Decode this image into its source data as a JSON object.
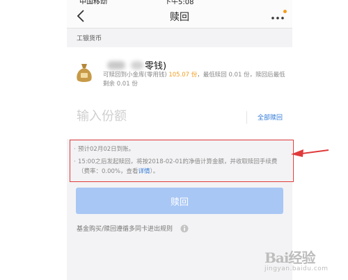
{
  "statusbar": {
    "left_fragment": "中国移动",
    "center_fragment": "下午5:08"
  },
  "nav": {
    "title": "赎回",
    "more_badge_color": "#f39c1e"
  },
  "section_label": "工银货币",
  "fund": {
    "name_visible": "零钱)",
    "desc_prefix": "可赎回到小金库(零用钱) ",
    "redeemable_shares": "105.07 份",
    "desc_suffix": "，最低赎回 0.01 份，赎回后最低剩余 0.01 份",
    "icon": "money-bag-icon"
  },
  "amount": {
    "placeholder": "输入份额",
    "value": "",
    "redeem_all_label": "全部赎回"
  },
  "notes": [
    {
      "text": "预计02月02日到账。"
    },
    {
      "text": "15:00之后发起赎回，将按2018-02-01的净值计算金额，并收取赎回手续费（费率：0.00%，查看",
      "link": "详情",
      "tail": "）。"
    }
  ],
  "redeem_button": {
    "label": "赎回",
    "color": "#a9c7f5"
  },
  "rules_text": "基金购买/赎回遵循多同卡进出规则",
  "annotation": {
    "color": "#e03a3a"
  },
  "watermark": {
    "main": "Bai经验",
    "sub": "jingyan.baidu.com"
  },
  "colors": {
    "accent": "#f39c1e",
    "link": "#2f7ad8",
    "page_bg": "#f3f3f5"
  }
}
